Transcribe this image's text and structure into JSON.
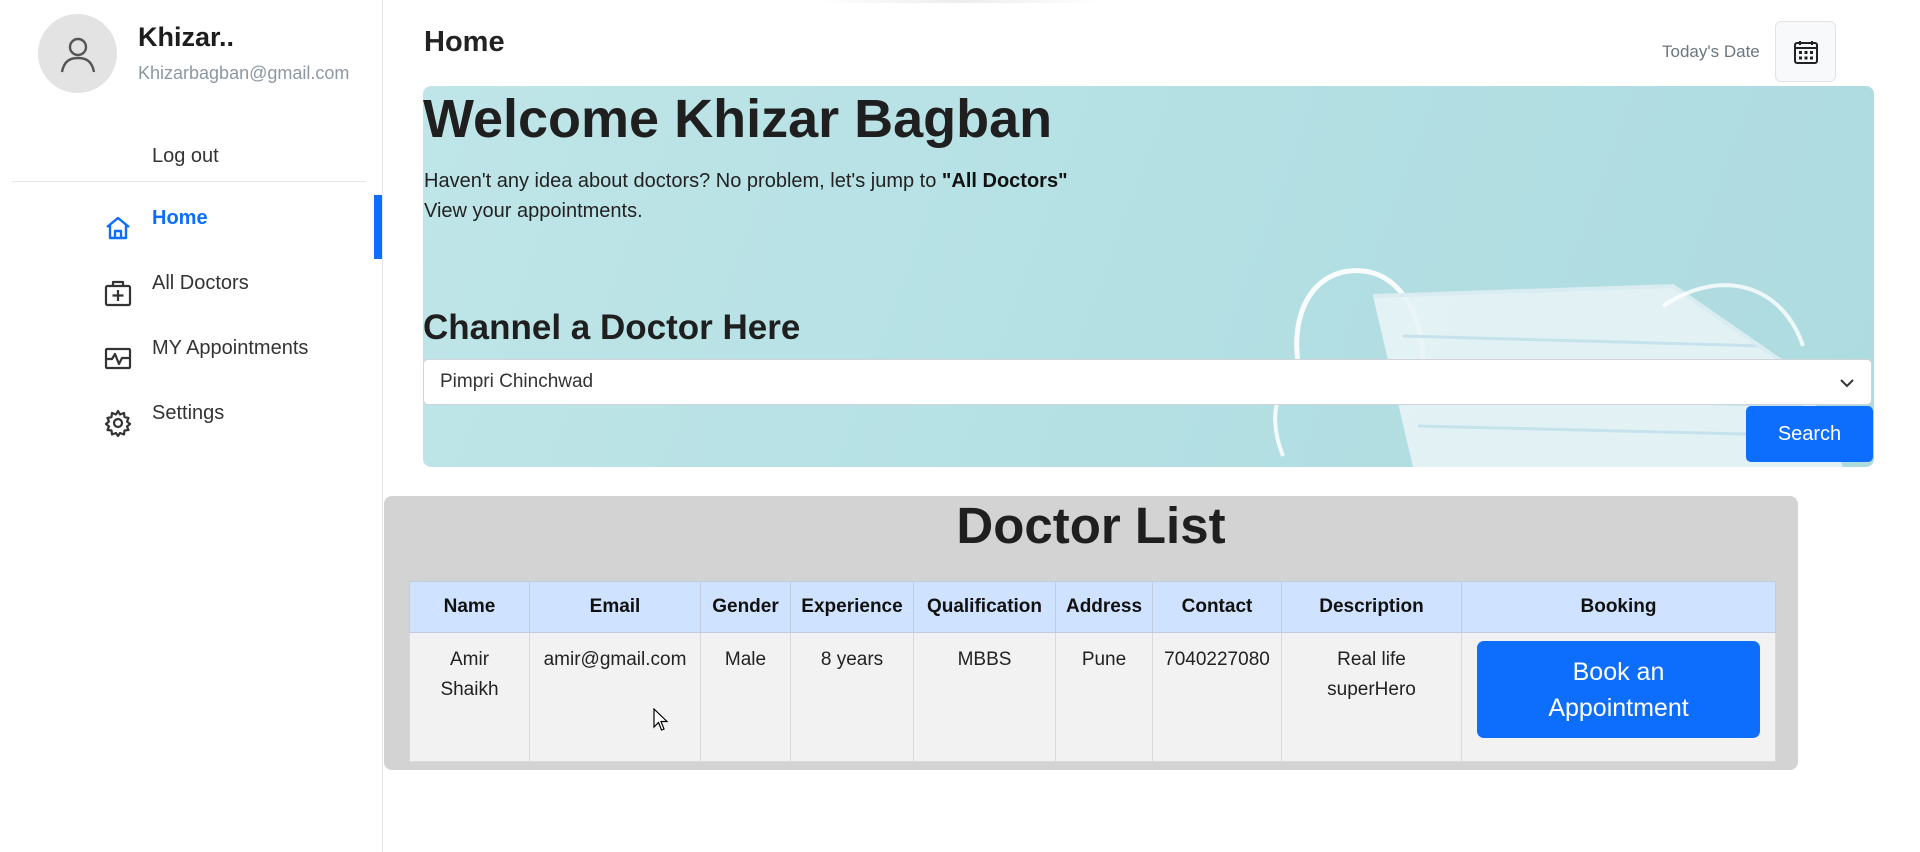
{
  "user": {
    "name": "Khizar..",
    "email": "Khizarbagban@gmail.com"
  },
  "sidebar": {
    "logout_label": "Log out",
    "items": [
      {
        "label": "Home",
        "icon": "home-icon",
        "active": true
      },
      {
        "label": "All Doctors",
        "icon": "medical-bag-icon",
        "active": false
      },
      {
        "label": "MY Appointments",
        "icon": "heartbeat-icon",
        "active": false
      },
      {
        "label": "Settings",
        "icon": "gear-icon",
        "active": false
      }
    ]
  },
  "header": {
    "title": "Home",
    "today_label": "Today's Date",
    "calendar_icon": "calendar-icon"
  },
  "hero": {
    "welcome": "Welcome Khizar Bagban",
    "line1_prefix": "Haven't any idea about doctors? No problem, let's jump to ",
    "line1_link": "\"All Doctors\"",
    "line2": "View your appointments.",
    "channel_title": "Channel a Doctor Here",
    "selected_city": "Pimpri Chinchwad",
    "search_label": "Search"
  },
  "doctor_list": {
    "title": "Doctor List",
    "columns": [
      "Name",
      "Email",
      "Gender",
      "Experience",
      "Qualification",
      "Address",
      "Contact",
      "Description",
      "Booking"
    ],
    "rows": [
      {
        "name": "Amir Shaikh",
        "email": "amir@gmail.com",
        "gender": "Male",
        "experience": "8 years",
        "qualification": "MBBS",
        "address": "Pune",
        "contact": "7040227080",
        "description": "Real life superHero",
        "booking_label": "Book an Appointment"
      }
    ]
  },
  "colors": {
    "accent": "#0d6efd",
    "table_header": "#cfe2ff",
    "panel": "#d3d3d3",
    "hero_bg": "#b4e0e4"
  }
}
